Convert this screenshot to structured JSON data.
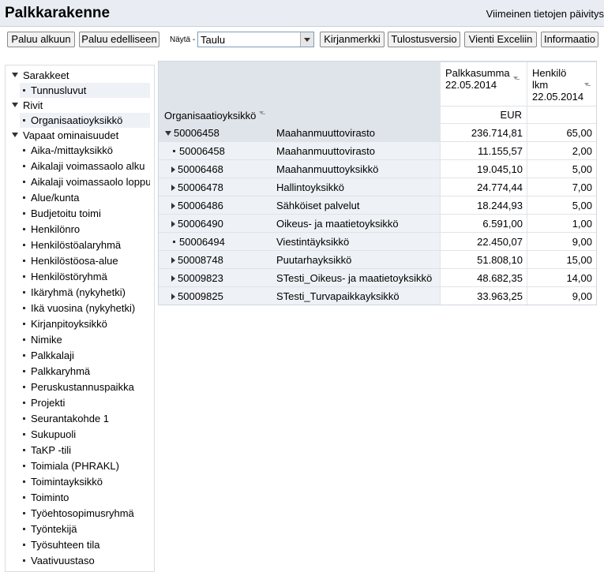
{
  "header": {
    "title": "Palkkarakenne",
    "last_update": "Viimeinen tietojen päivitys"
  },
  "toolbar": {
    "back_start": "Paluu alkuun",
    "back_prev": "Paluu edelliseen",
    "show_label": "Näytä -",
    "show_value": "Taulu",
    "bookmark": "Kirjanmerkki",
    "print": "Tulostusversio",
    "excel": "Vienti Exceliin",
    "info": "Informaatio"
  },
  "sidebar": {
    "sections": [
      {
        "label": "Sarakkeet"
      },
      {
        "label": "Rivit"
      },
      {
        "label": "Vapaat ominaisuudet"
      }
    ],
    "columns_items": [
      "Tunnusluvut"
    ],
    "rows_items": [
      "Organisaatioyksikkö"
    ],
    "free_items": [
      "Aika-/mittayksikkö",
      "Aikalaji voimassaolo alku",
      "Aikalaji voimassaolo loppu",
      "Alue/kunta",
      "Budjetoitu toimi",
      "Henkilönro",
      "Henkilöstöalaryhmä",
      "Henkilöstöosa-alue",
      "Henkilöstöryhmä",
      "Ikäryhmä (nykyhetki)",
      "Ikä vuosina (nykyhetki)",
      "Kirjanpitoyksikkö",
      "Nimike",
      "Palkkalaji",
      "Palkkaryhmä",
      "Peruskustannuspaikka",
      "Projekti",
      "Seurantakohde 1",
      "Sukupuoli",
      "TaKP -tili",
      "Toimiala (PHRAKL)",
      "Toimintayksikkö",
      "Toiminto",
      "Työehtosopimusryhmä",
      "Työntekijä",
      "Työsuhteen tila",
      "Vaativuustaso"
    ]
  },
  "table": {
    "row_header": "Organisaatioyksikkö",
    "col1_line1": "Palkkasumma",
    "col1_line2": "22.05.2014",
    "col1_unit": "EUR",
    "col2_line1": "Henkilö",
    "col2_line2": "lkm",
    "col2_line3": "22.05.2014",
    "rows": [
      {
        "code": "50006458",
        "name": "Maahanmuuttovirasto",
        "sum": "236.714,81",
        "count": "65,00"
      },
      {
        "code": "50006458",
        "name": "Maahanmuuttovirasto",
        "sum": "11.155,57",
        "count": "2,00"
      },
      {
        "code": "50006468",
        "name": "Maahanmuuttoyksikkö",
        "sum": "19.045,10",
        "count": "5,00"
      },
      {
        "code": "50006478",
        "name": "Hallintoyksikkö",
        "sum": "24.774,44",
        "count": "7,00"
      },
      {
        "code": "50006486",
        "name": "Sähköiset palvelut",
        "sum": "18.244,93",
        "count": "5,00"
      },
      {
        "code": "50006490",
        "name": "Oikeus- ja maatietoyksikkö",
        "sum": "6.591,00",
        "count": "1,00"
      },
      {
        "code": "50006494",
        "name": "Viestintäyksikkö",
        "sum": "22.450,07",
        "count": "9,00"
      },
      {
        "code": "50008748",
        "name": "Puutarhayksikkö",
        "sum": "51.808,10",
        "count": "15,00"
      },
      {
        "code": "50009823",
        "name": "STesti_Oikeus- ja maatietoyksikkö",
        "sum": "48.682,35",
        "count": "14,00"
      },
      {
        "code": "50009825",
        "name": "STesti_Turvapaikkayksikkö",
        "sum": "33.963,25",
        "count": "9,00"
      }
    ]
  }
}
